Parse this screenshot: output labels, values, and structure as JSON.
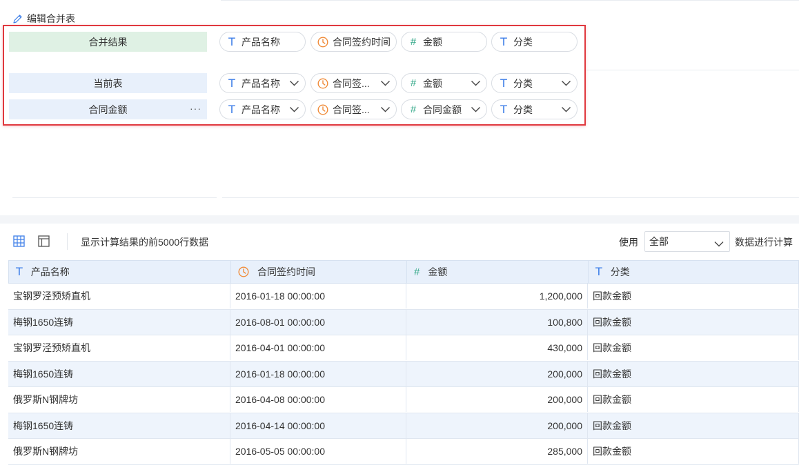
{
  "edit_section": {
    "title": "编辑合并表",
    "result_label": "合并结果",
    "result_fields": [
      {
        "icon": "text-type-icon",
        "label": "产品名称"
      },
      {
        "icon": "clock-icon",
        "label": "合同签约时间"
      },
      {
        "icon": "hash-icon",
        "label": "金额"
      },
      {
        "icon": "text-type-icon",
        "label": "分类"
      }
    ],
    "tables": [
      {
        "label": "当前表",
        "fields": [
          {
            "icon": "text-type-icon",
            "label": "产品名称"
          },
          {
            "icon": "clock-icon",
            "label": "合同签..."
          },
          {
            "icon": "hash-icon",
            "label": "金额"
          },
          {
            "icon": "text-type-icon",
            "label": "分类"
          }
        ]
      },
      {
        "label": "合同金额",
        "more": "···",
        "fields": [
          {
            "icon": "text-type-icon",
            "label": "产品名称"
          },
          {
            "icon": "clock-icon",
            "label": "合同签..."
          },
          {
            "icon": "hash-icon",
            "label": "合同金额"
          },
          {
            "icon": "text-type-icon",
            "label": "分类"
          }
        ]
      }
    ]
  },
  "toolbar": {
    "note": "显示计算结果的前5000行数据",
    "use_label": "使用",
    "use_value": "全部",
    "use_suffix": "数据进行计算"
  },
  "table": {
    "columns": [
      {
        "icon": "text-type-icon",
        "label": "产品名称"
      },
      {
        "icon": "clock-icon",
        "label": "合同签约时间"
      },
      {
        "icon": "hash-icon",
        "label": "金额"
      },
      {
        "icon": "text-type-icon",
        "label": "分类"
      }
    ],
    "rows": [
      [
        "宝钢罗泾预矫直机",
        "2016-01-18 00:00:00",
        "1,200,000",
        "回款金额"
      ],
      [
        "梅钢1650连铸",
        "2016-08-01 00:00:00",
        "100,800",
        "回款金额"
      ],
      [
        "宝钢罗泾预矫直机",
        "2016-04-01 00:00:00",
        "430,000",
        "回款金额"
      ],
      [
        "梅钢1650连铸",
        "2016-01-18 00:00:00",
        "200,000",
        "回款金额"
      ],
      [
        "俄罗斯N钢牌坊",
        "2016-04-08 00:00:00",
        "200,000",
        "回款金额"
      ],
      [
        "梅钢1650连铸",
        "2016-04-14 00:00:00",
        "200,000",
        "回款金额"
      ],
      [
        "俄罗斯N钢牌坊",
        "2016-05-05 00:00:00",
        "285,000",
        "回款金额"
      ]
    ]
  },
  "colors": {
    "accent_blue": "#3d7ee8",
    "clock_orange": "#f08c3a",
    "hash_green": "#33a888",
    "highlight_red": "#e0383e",
    "result_green_bg": "#dff1e4",
    "row_blue_bg": "#e8f0fb"
  }
}
